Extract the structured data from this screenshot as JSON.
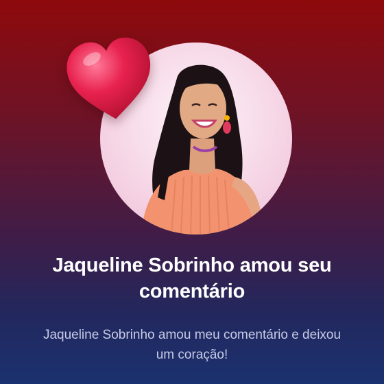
{
  "notification": {
    "title": "Jaqueline Sobrinho amou seu comentário",
    "message": "Jaqueline Sobrinho amou meu comentário e deixou um coração!"
  },
  "icons": {
    "reaction": "heart-icon"
  },
  "colors": {
    "background_top": "#8e0a0c",
    "background_bottom": "#1b3170",
    "heart": "#e8224f",
    "title": "#ffffff",
    "subtitle": "#c9cbe6"
  }
}
